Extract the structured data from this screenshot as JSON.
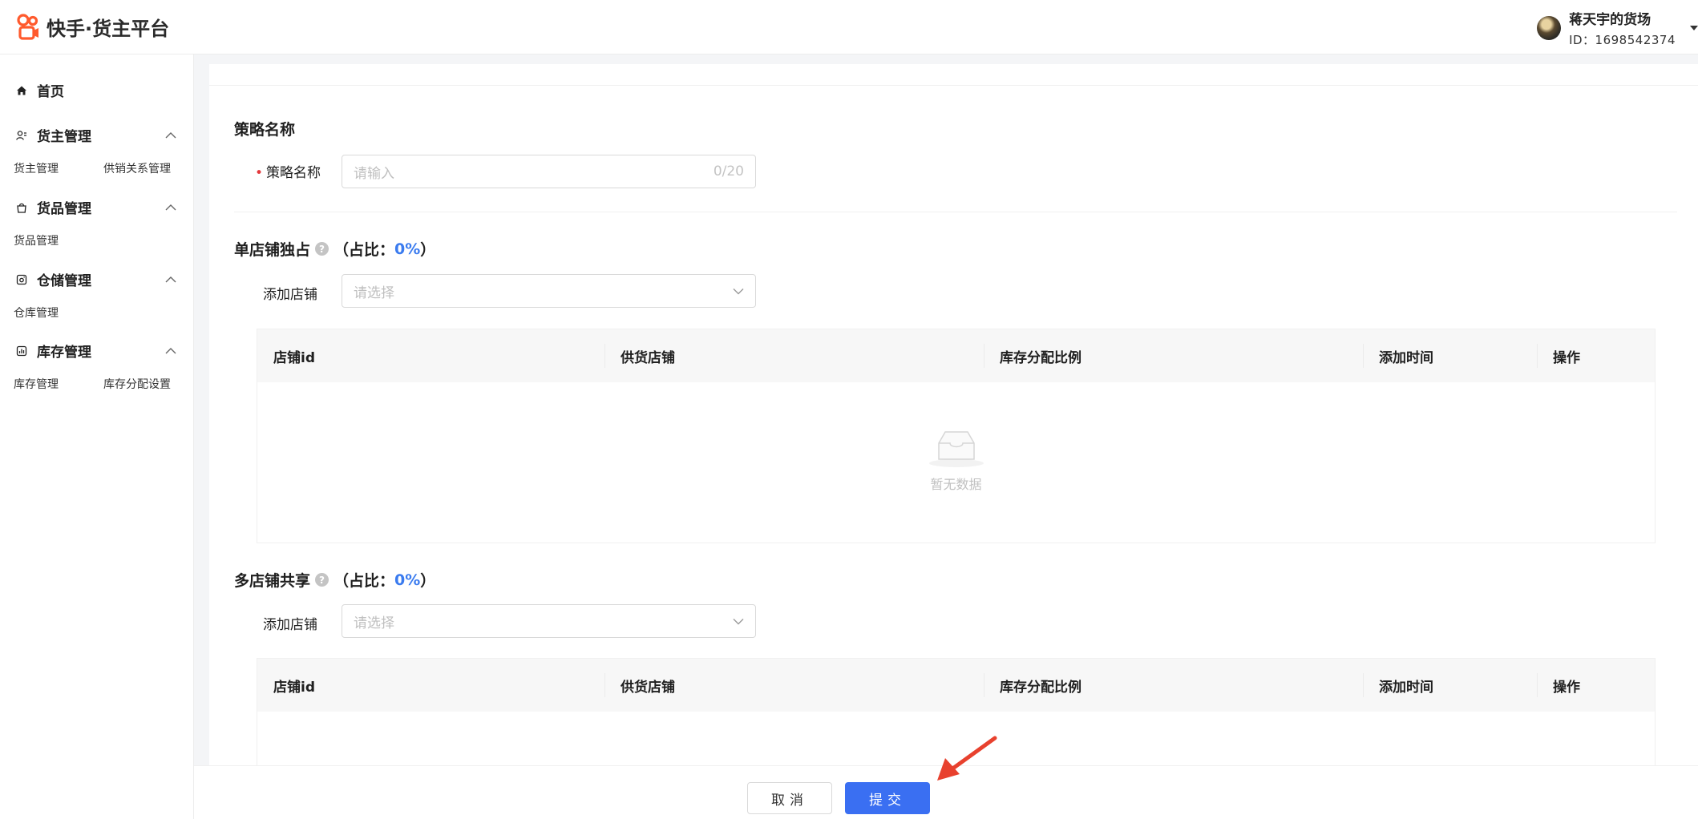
{
  "header": {
    "title": "快手·货主平台",
    "user_name": "蒋天宇的货场",
    "user_id": "ID：1698542374"
  },
  "sidebar": {
    "home": "首页",
    "groups": [
      {
        "label": "货主管理",
        "subs": [
          "货主管理",
          "供销关系管理"
        ]
      },
      {
        "label": "货品管理",
        "subs": [
          "货品管理"
        ]
      },
      {
        "label": "仓储管理",
        "subs": [
          "仓库管理"
        ]
      },
      {
        "label": "库存管理",
        "subs": [
          "库存管理",
          "库存分配设置"
        ]
      }
    ]
  },
  "form": {
    "section1_title": "策略名称",
    "name_label": "策略名称",
    "name_placeholder": "请输入",
    "name_count": "0/20",
    "section2_title": "单店铺独占",
    "section2_ratio_prefix": "（占比：",
    "section2_ratio_value": "0%",
    "section2_ratio_suffix": "）",
    "add_store_label": "添加店铺",
    "add_store_placeholder": "请选择",
    "section3_title": "多店铺共享",
    "section3_ratio_prefix": "（占比：",
    "section3_ratio_value": "0%",
    "section3_ratio_suffix": "）",
    "add_store_label2": "添加店铺",
    "add_store_placeholder2": "请选择"
  },
  "table": {
    "columns": [
      "店铺id",
      "供货店铺",
      "库存分配比例",
      "添加时间",
      "操作"
    ],
    "empty_text": "暂无数据"
  },
  "footer": {
    "cancel": "取消",
    "submit": "提交"
  },
  "colors": {
    "accent": "#3a6ff2",
    "ratio": "#3a7bef",
    "arrow": "#e8412e",
    "logo": "#ff5a2d"
  }
}
